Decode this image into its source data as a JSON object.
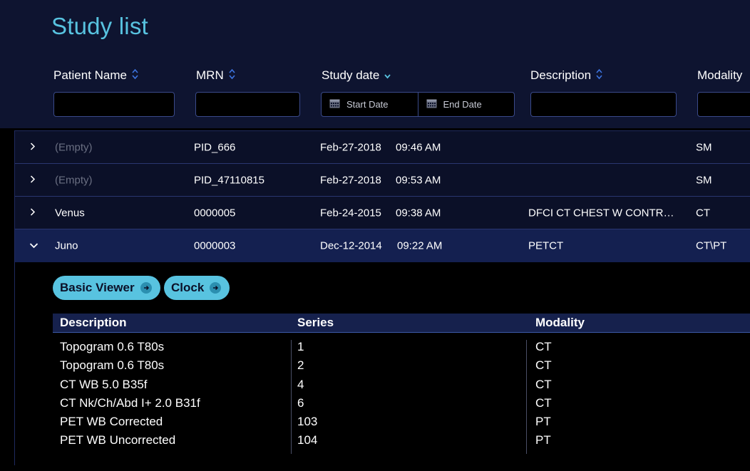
{
  "page": {
    "title": "Study list"
  },
  "filters": {
    "patient_name": {
      "label": "Patient Name",
      "value": ""
    },
    "mrn": {
      "label": "MRN",
      "value": ""
    },
    "study_date": {
      "label": "Study date",
      "start_placeholder": "Start Date",
      "end_placeholder": "End Date"
    },
    "description": {
      "label": "Description",
      "value": ""
    },
    "modality": {
      "label": "Modality",
      "value": ""
    }
  },
  "studies": [
    {
      "name": "(Empty)",
      "mrn": "PID_666",
      "date": "Feb-27-2018",
      "time": "09:46 AM",
      "description": "",
      "modality": "SM"
    },
    {
      "name": "(Empty)",
      "mrn": "PID_47110815",
      "date": "Feb-27-2018",
      "time": "09:53 AM",
      "description": "",
      "modality": "SM"
    },
    {
      "name": "Venus",
      "mrn": "0000005",
      "date": "Feb-24-2015",
      "time": "09:38 AM",
      "description": "DFCI CT CHEST W CONTR…",
      "modality": "CT"
    },
    {
      "name": "Juno",
      "mrn": "0000003",
      "date": "Dec-12-2014",
      "time": "09:22 AM",
      "description": "PETCT",
      "modality": "CT\\PT"
    }
  ],
  "expanded": {
    "actions": {
      "basic_viewer": "Basic Viewer",
      "clock": "Clock"
    },
    "series_headers": {
      "description": "Description",
      "series": "Series",
      "modality": "Modality"
    },
    "series": [
      {
        "description": "Topogram 0.6 T80s",
        "series": "1",
        "modality": "CT"
      },
      {
        "description": "Topogram 0.6 T80s",
        "series": "2",
        "modality": "CT"
      },
      {
        "description": "CT WB 5.0 B35f",
        "series": "4",
        "modality": "CT"
      },
      {
        "description": "CT Nk/Ch/Abd I+ 2.0 B31f",
        "series": "6",
        "modality": "CT"
      },
      {
        "description": "PET WB Corrected",
        "series": "103",
        "modality": "PT"
      },
      {
        "description": "PET WB Uncorrected",
        "series": "104",
        "modality": "PT"
      }
    ]
  },
  "colors": {
    "accent": "#58c3e0",
    "header_bg": "#0e1430",
    "row_bg": "#0b1028",
    "expanded_row_bg": "#142050"
  }
}
